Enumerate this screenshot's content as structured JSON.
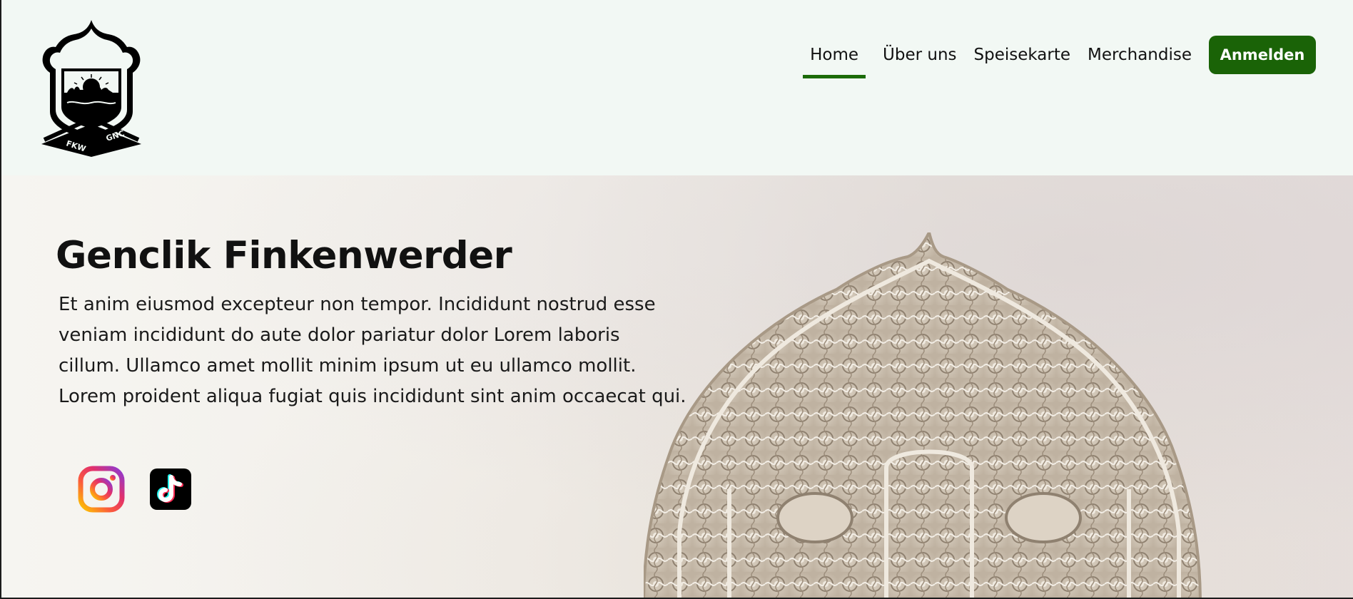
{
  "brand": {
    "logo_alt": "Genclik Finkenwerder logo",
    "logo_left_text": "FKW",
    "logo_right_text": "GNC"
  },
  "nav": {
    "items": [
      {
        "label": "Home",
        "active": true
      },
      {
        "label": "Über uns",
        "active": false
      },
      {
        "label": "Speisekarte",
        "active": false
      },
      {
        "label": "Merchandise",
        "active": false
      }
    ],
    "login_label": "Anmelden"
  },
  "hero": {
    "title": "Genclik Finkenwerder",
    "text": "Et anim eiusmod excepteur non tempor. Incididunt nostrud esse veniam incididunt do aute dolor pariatur dolor Lorem laboris cillum. Ullamco amet mollit minim ipsum ut eu ullamco mollit. Lorem proident aliqua fugiat quis incididunt sint anim occaecat qui."
  },
  "social": {
    "instagram_icon": "instagram-icon",
    "tiktok_icon": "tiktok-icon"
  },
  "colors": {
    "accent": "#1a6307",
    "header_bg": "#f2f8f4"
  }
}
